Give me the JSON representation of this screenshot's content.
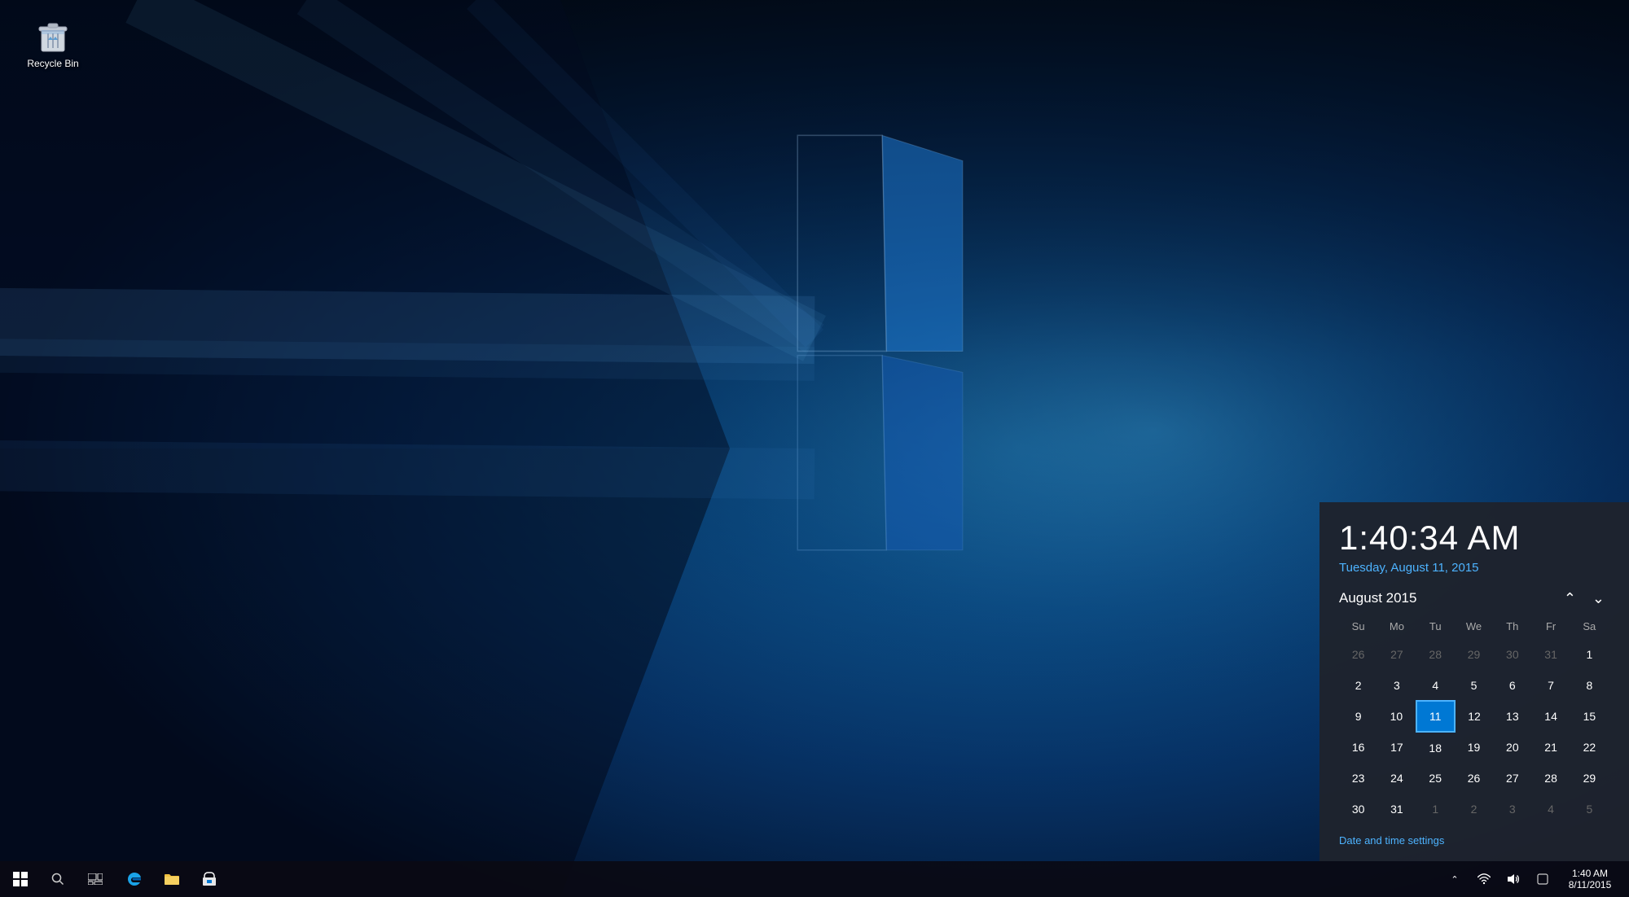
{
  "desktop": {
    "background_colors": [
      "#1a6fa8",
      "#0d4d8a",
      "#0a3060",
      "#061e3e"
    ]
  },
  "recycle_bin": {
    "label": "Recycle Bin"
  },
  "taskbar": {
    "start_label": "Start",
    "search_label": "Search",
    "task_view_label": "Task View",
    "apps": [
      {
        "name": "Microsoft Edge",
        "icon": "edge"
      },
      {
        "name": "File Explorer",
        "icon": "folder"
      },
      {
        "name": "Store",
        "icon": "store"
      }
    ],
    "tray": {
      "chevron": "^",
      "network_icon": "network",
      "volume_icon": "volume",
      "time": "1:40 AM",
      "date": "8/11/2015"
    }
  },
  "calendar_popup": {
    "time": "1:40:34 AM",
    "date_full": "Tuesday, August 11, 2015",
    "month_year": "August 2015",
    "nav_prev": "^",
    "nav_next": "v",
    "day_headers": [
      "Su",
      "Mo",
      "Tu",
      "We",
      "Th",
      "Fr",
      "Sa"
    ],
    "weeks": [
      [
        {
          "day": "26",
          "other": true
        },
        {
          "day": "27",
          "other": true
        },
        {
          "day": "28",
          "other": true
        },
        {
          "day": "29",
          "other": true
        },
        {
          "day": "30",
          "other": true
        },
        {
          "day": "31",
          "other": true
        },
        {
          "day": "1",
          "other": false
        }
      ],
      [
        {
          "day": "2",
          "other": false
        },
        {
          "day": "3",
          "other": false
        },
        {
          "day": "4",
          "other": false
        },
        {
          "day": "5",
          "other": false
        },
        {
          "day": "6",
          "other": false
        },
        {
          "day": "7",
          "other": false
        },
        {
          "day": "8",
          "other": false
        }
      ],
      [
        {
          "day": "9",
          "other": false
        },
        {
          "day": "10",
          "other": false
        },
        {
          "day": "11",
          "other": false,
          "today": true
        },
        {
          "day": "12",
          "other": false
        },
        {
          "day": "13",
          "other": false
        },
        {
          "day": "14",
          "other": false
        },
        {
          "day": "15",
          "other": false
        }
      ],
      [
        {
          "day": "16",
          "other": false
        },
        {
          "day": "17",
          "other": false
        },
        {
          "day": "18",
          "other": false
        },
        {
          "day": "19",
          "other": false
        },
        {
          "day": "20",
          "other": false
        },
        {
          "day": "21",
          "other": false
        },
        {
          "day": "22",
          "other": false
        }
      ],
      [
        {
          "day": "23",
          "other": false
        },
        {
          "day": "24",
          "other": false
        },
        {
          "day": "25",
          "other": false
        },
        {
          "day": "26",
          "other": false
        },
        {
          "day": "27",
          "other": false
        },
        {
          "day": "28",
          "other": false
        },
        {
          "day": "29",
          "other": false
        }
      ],
      [
        {
          "day": "30",
          "other": false
        },
        {
          "day": "31",
          "other": false
        },
        {
          "day": "1",
          "other": true
        },
        {
          "day": "2",
          "other": true
        },
        {
          "day": "3",
          "other": true
        },
        {
          "day": "4",
          "other": true
        },
        {
          "day": "5",
          "other": true
        }
      ]
    ],
    "settings_link": "Date and time settings"
  }
}
